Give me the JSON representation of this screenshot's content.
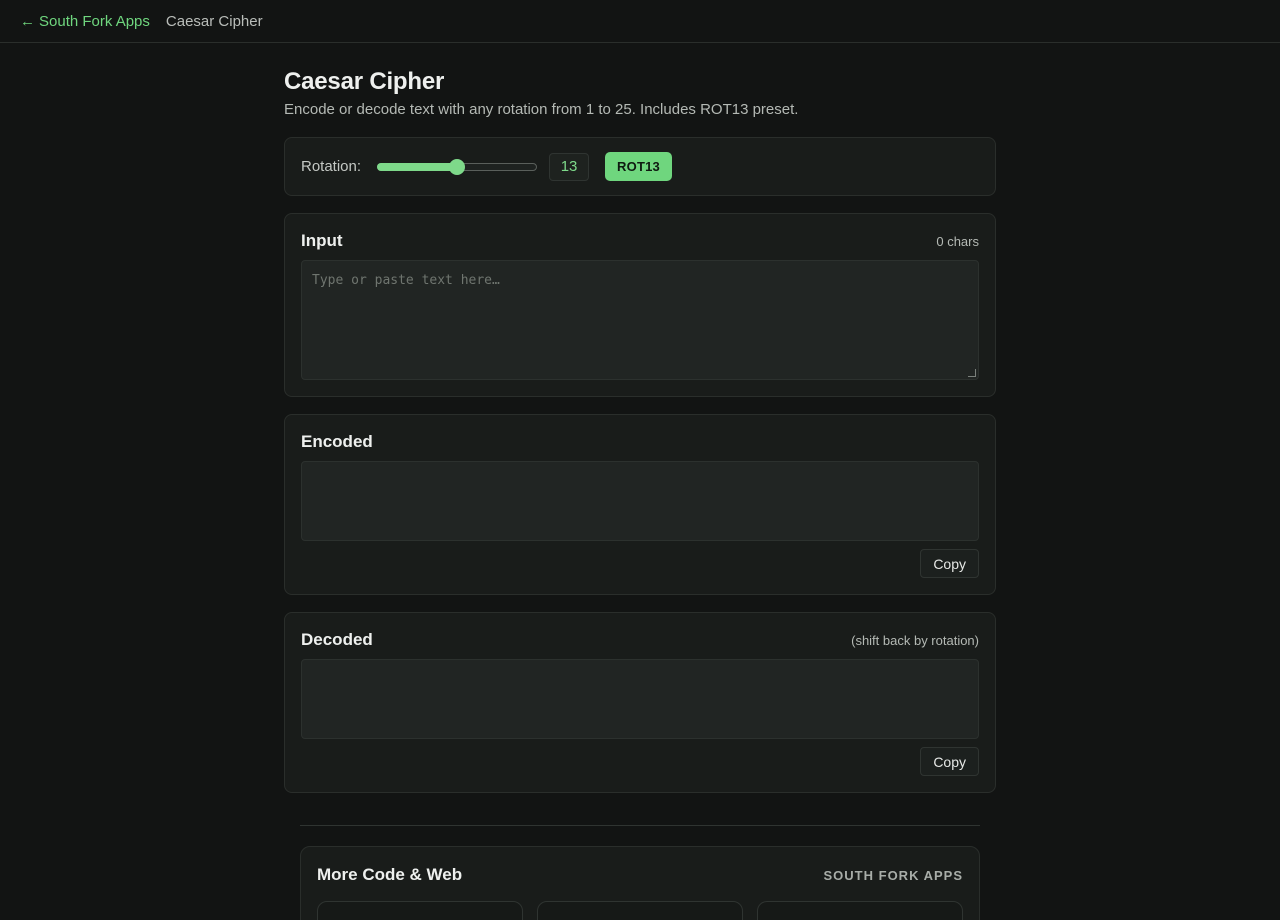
{
  "nav": {
    "back_arrow": "←",
    "back_label": "South Fork Apps",
    "current": "Caesar Cipher"
  },
  "page": {
    "title": "Caesar Cipher",
    "subtitle": "Encode or decode text with any rotation from 1 to 25. Includes ROT13 preset."
  },
  "rotation": {
    "label": "Rotation:",
    "min": 1,
    "max": 25,
    "value": 13,
    "value_text": "13",
    "preset_label": "ROT13"
  },
  "input": {
    "title": "Input",
    "count": "0 chars",
    "placeholder": "Type or paste text here…",
    "value": ""
  },
  "encoded": {
    "title": "Encoded",
    "value": "",
    "copy_label": "Copy"
  },
  "decoded": {
    "title": "Decoded",
    "note": "(shift back by rotation)",
    "value": "",
    "copy_label": "Copy"
  },
  "more": {
    "title": "More Code & Web",
    "brand": "SOUTH FORK APPS"
  },
  "colors": {
    "accent": "#6fd67e",
    "background": "#121413",
    "card": "#191c1a"
  }
}
